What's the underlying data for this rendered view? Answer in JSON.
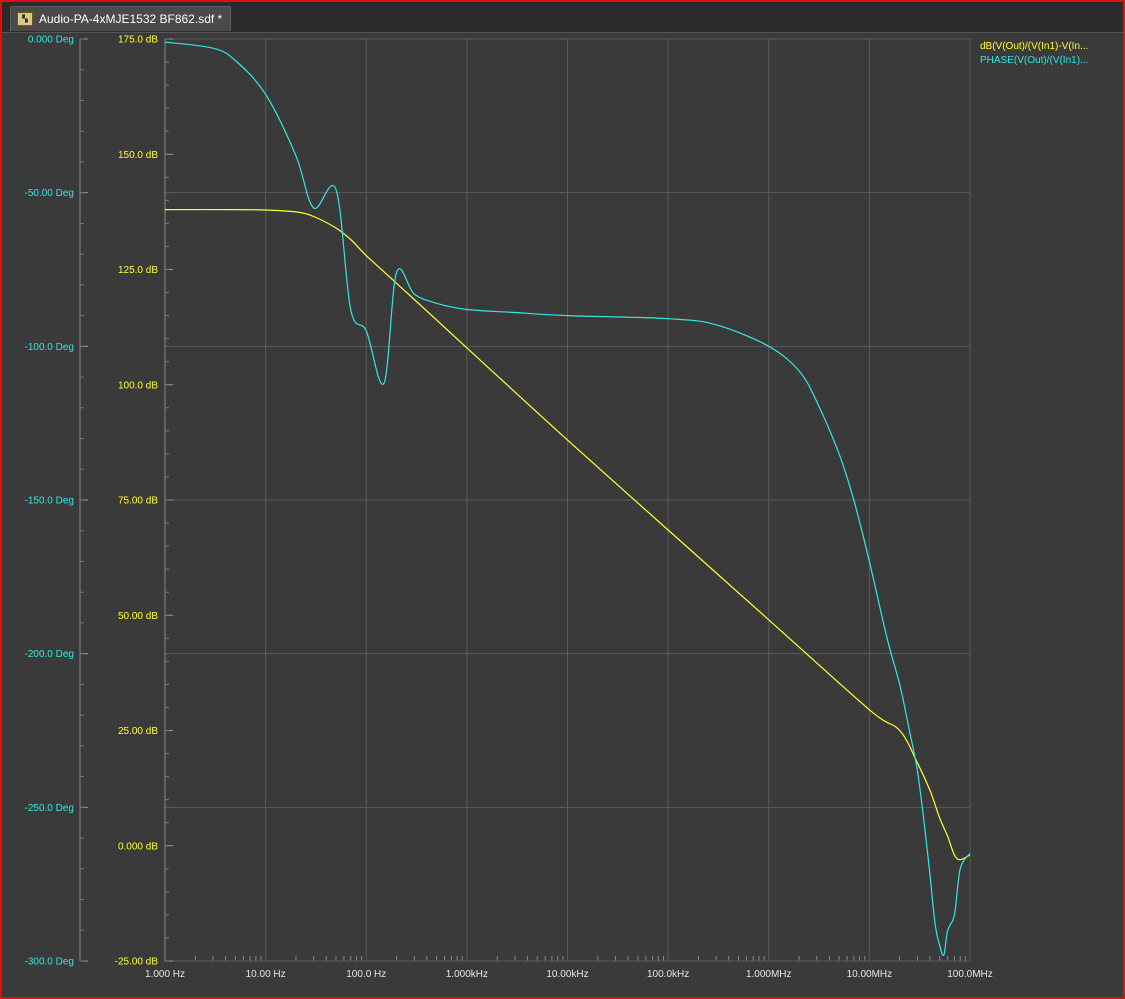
{
  "window": {
    "tab_title": "Audio-PA-4xMJE1532 BF862.sdf *",
    "tab_icon": "waveform-doc-icon"
  },
  "colors": {
    "background": "#3a3a3a",
    "grid": "#5a5a5a",
    "magnitude": "#ffff33",
    "phase": "#33e6e6",
    "window_border": "#e01010"
  },
  "chart_data": {
    "type": "line",
    "x_scale": "log",
    "x_range": [
      1,
      100000000
    ],
    "x_tick_labels": [
      "1.000 Hz",
      "10.00 Hz",
      "100.0 Hz",
      "1.000kHz",
      "10.00kHz",
      "100.0kHz",
      "1.000MHz",
      "10.00MHz",
      "100.0MHz"
    ],
    "x_tick_values": [
      1,
      10,
      100,
      1000,
      10000,
      100000,
      1000000,
      10000000,
      100000000
    ],
    "left_axis": {
      "range": [
        -300,
        0
      ],
      "tick_values": [
        0,
        -50,
        -100,
        -150,
        -200,
        -250,
        -300
      ],
      "tick_labels": [
        "0.000 Deg",
        "-50.00 Deg",
        "-100.0 Deg",
        "-150.0 Deg",
        "-200.0 Deg",
        "-250.0 Deg",
        "-300.0 Deg"
      ]
    },
    "right_axis": {
      "range": [
        -25,
        175
      ],
      "tick_values": [
        175,
        150,
        125,
        100,
        75,
        50,
        25,
        0,
        -25
      ],
      "tick_labels": [
        "175.0 dB",
        "150.0 dB",
        "125.0 dB",
        "100.0 dB",
        "75.00 dB",
        "50.00 dB",
        "25.00 dB",
        "0.000 dB",
        "-25.00 dB"
      ]
    },
    "grid": true,
    "legend_position": "top-right",
    "series": [
      {
        "name": "dB(V(Out)/(V(In1)-V(In...",
        "axis": "right",
        "color": "#ffff33",
        "x": [
          1,
          5,
          10,
          20,
          30,
          50,
          70,
          100,
          150,
          200,
          300,
          1000,
          10000,
          100000,
          1000000,
          10000000,
          20000000,
          30000000,
          40000000,
          50000000,
          60000000,
          70000000,
          80000000,
          100000000
        ],
        "y": [
          138,
          138,
          137.9,
          137.5,
          136.5,
          134,
          131.5,
          128,
          124.5,
          122,
          118.5,
          108,
          88,
          68.5,
          49,
          29.5,
          25,
          18,
          12,
          6,
          2,
          -2,
          -3,
          -2
        ]
      },
      {
        "name": "PHASE(V(Out)/(V(In1)...",
        "axis": "left",
        "color": "#33e6e6",
        "x": [
          1,
          3,
          5,
          10,
          20,
          30,
          50,
          70,
          100,
          150,
          200,
          300,
          500,
          1000,
          3000,
          10000,
          100000,
          300000,
          1000000,
          2000000,
          3000000,
          5000000,
          7000000,
          10000000,
          15000000,
          20000000,
          25000000,
          30000000,
          35000000,
          40000000,
          45000000,
          50000000,
          55000000,
          60000000,
          70000000,
          80000000,
          100000000
        ],
        "y": [
          -1,
          -3,
          -7,
          -18,
          -38,
          -55,
          -49,
          -88,
          -95,
          -112,
          -76,
          -83,
          -86,
          -88,
          -89,
          -90,
          -91,
          -93,
          -100,
          -108,
          -118,
          -135,
          -150,
          -170,
          -195,
          -210,
          -225,
          -238,
          -255,
          -272,
          -288,
          -295,
          -298,
          -290,
          -285,
          -270,
          -265
        ]
      }
    ]
  },
  "legend": {
    "magnitude_label": "dB(V(Out)/(V(In1)-V(In...",
    "phase_label": "PHASE(V(Out)/(V(In1)..."
  }
}
